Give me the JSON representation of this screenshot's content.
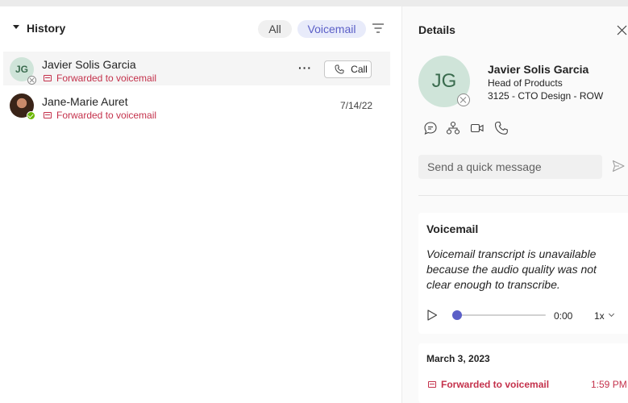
{
  "history": {
    "title": "History",
    "filters": {
      "all": "All",
      "voicemail": "Voicemail"
    },
    "rows": [
      {
        "initials": "JG",
        "name": "Javier Solis Garcia",
        "status": "Forwarded to voicemail",
        "more": "···",
        "call_label": "Call"
      },
      {
        "name": "Jane-Marie Auret",
        "status": "Forwarded to voicemail",
        "date": "7/14/22"
      }
    ]
  },
  "details": {
    "title": "Details",
    "initials": "JG",
    "name": "Javier Solis Garcia",
    "role": "Head of Products",
    "location": "3125 - CTO Design - ROW",
    "quick_message_placeholder": "Send a quick message",
    "voicemail": {
      "title": "Voicemail",
      "transcript": "Voicemail transcript is unavailable because the audio quality was not clear enough to transcribe.",
      "time": "0:00",
      "speed": "1x",
      "progress": 0
    },
    "entry": {
      "date": "March 3, 2023",
      "status": "Forwarded to voicemail",
      "time": "1:59 PM"
    }
  },
  "colors": {
    "accent": "#5b5fc7",
    "missed": "#c4314b",
    "avatar_bg": "#cfe4d9",
    "online": "#6bb700"
  }
}
